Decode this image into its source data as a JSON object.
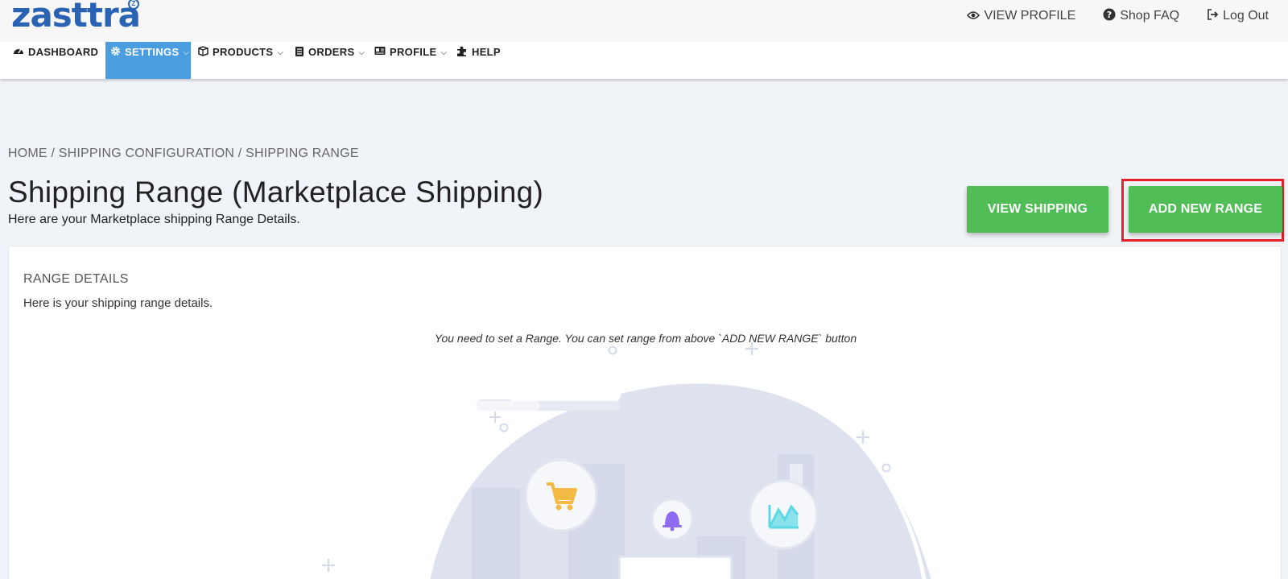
{
  "brand": {
    "logo_text": "zasttra",
    "logo_badge": "Z"
  },
  "top_links": [
    {
      "label": "VIEW PROFILE",
      "icon": "eye-icon"
    },
    {
      "label": "Shop FAQ",
      "icon": "question-circle-icon"
    },
    {
      "label": "Log Out",
      "icon": "logout-icon"
    }
  ],
  "nav": [
    {
      "label": "DASHBOARD",
      "icon": "dashboard-icon",
      "caret": false,
      "active": false
    },
    {
      "label": "SETTINGS",
      "icon": "gear-icon",
      "caret": true,
      "active": true
    },
    {
      "label": "PRODUCTS",
      "icon": "box-icon",
      "caret": true,
      "active": false
    },
    {
      "label": "ORDERS",
      "icon": "list-icon",
      "caret": true,
      "active": false
    },
    {
      "label": "PROFILE",
      "icon": "id-card-icon",
      "caret": true,
      "active": false
    },
    {
      "label": "HELP",
      "icon": "puzzle-icon",
      "caret": false,
      "active": false
    }
  ],
  "breadcrumb": {
    "items": [
      "HOME",
      "SHIPPING CONFIGURATION",
      "SHIPPING RANGE"
    ],
    "separator": "/"
  },
  "page": {
    "title": "Shipping Range (Marketplace Shipping)",
    "subtitle": "Here are your Marketplace shipping Range Details."
  },
  "actions": {
    "view_shipping": "VIEW SHIPPING",
    "add_new_range": "ADD NEW RANGE"
  },
  "card": {
    "title": "RANGE DETAILS",
    "subtitle": "Here is your shipping range details.",
    "empty_note": "You need to set a Range. You can set range from above `ADD NEW RANGE` button"
  },
  "colors": {
    "brand_blue": "#2a63b3",
    "nav_active": "#4a9ee0",
    "button_green": "#50bd56",
    "highlight_red": "#e5202a",
    "page_bg": "#f0f3f8",
    "illustration_blob": "#dde2ee"
  }
}
